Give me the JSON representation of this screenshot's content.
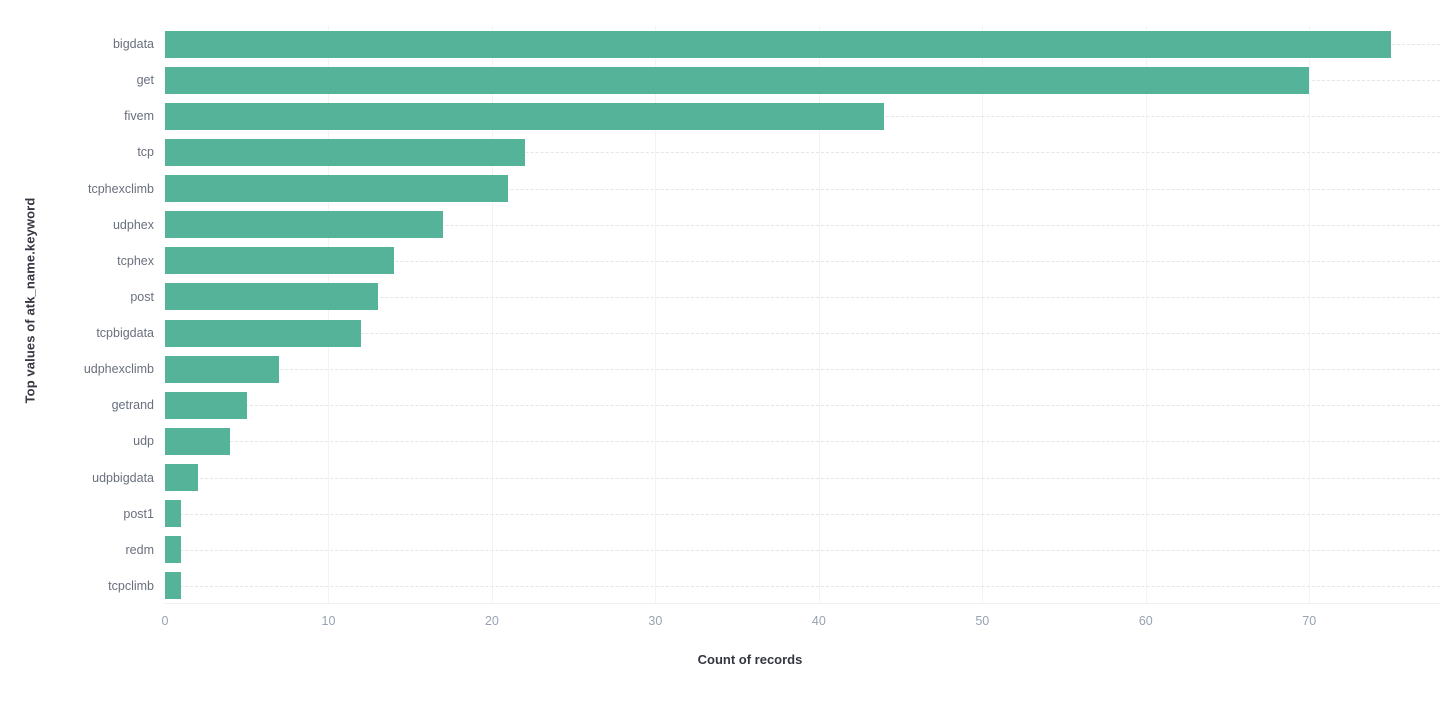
{
  "chart_data": {
    "type": "bar",
    "orientation": "horizontal",
    "title": "",
    "xlabel": "Count of records",
    "ylabel": "Top values of atk_name.keyword",
    "categories": [
      "bigdata",
      "get",
      "fivem",
      "tcp",
      "tcphexclimb",
      "udphex",
      "tcphex",
      "post",
      "tcpbigdata",
      "udphexclimb",
      "getrand",
      "udp",
      "udpbigdata",
      "post1",
      "redm",
      "tcpclimb"
    ],
    "values": [
      75,
      70,
      44,
      22,
      21,
      17,
      14,
      13,
      12,
      7,
      5,
      4,
      2,
      1,
      1,
      1
    ],
    "series": [
      {
        "name": "Count of records",
        "values": [
          75,
          70,
          44,
          22,
          21,
          17,
          14,
          13,
          12,
          7,
          5,
          4,
          2,
          1,
          1,
          1
        ]
      }
    ],
    "xlim": [
      0,
      78
    ],
    "ylim": null,
    "xticks": [
      0,
      10,
      20,
      30,
      40,
      50,
      60,
      70
    ],
    "xtick_labels": [
      "0",
      "10",
      "20",
      "30",
      "40",
      "50",
      "60",
      "70"
    ],
    "grid": {
      "horizontal": true,
      "horizontal_style": "dashed",
      "vertical": true,
      "vertical_style": "solid"
    },
    "legend": null,
    "legend_position": "none",
    "bar_color": "#54b399",
    "background_color": "#ffffff",
    "axis_label_color": "#69707d",
    "axis_title_color": "#343741"
  }
}
